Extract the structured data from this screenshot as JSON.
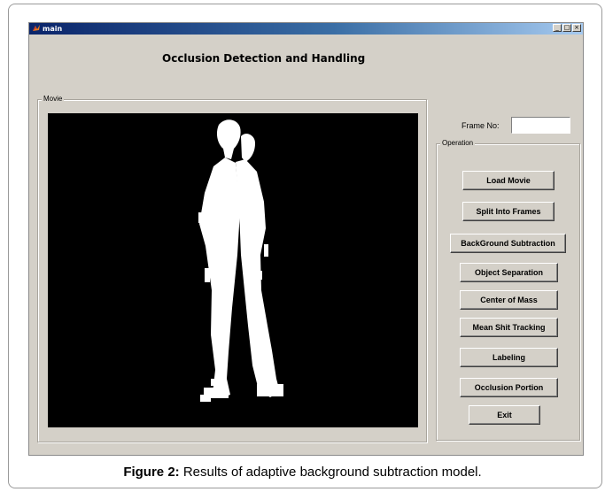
{
  "window": {
    "title": "main",
    "controls": {
      "minimize": "_",
      "maximize": "□",
      "close": "×"
    }
  },
  "heading": "Occlusion Detection and Handling",
  "movie_panel": {
    "label": "Movie"
  },
  "frame": {
    "label": "Frame No:",
    "value": ""
  },
  "operation_panel": {
    "label": "Operation",
    "buttons": [
      "Load Movie",
      "Split Into Frames",
      "BackGround Subtraction",
      "Object Separation",
      "Center of Mass",
      "Mean Shit Tracking",
      "Labeling",
      "Occlusion Portion",
      "Exit"
    ]
  },
  "caption": {
    "prefix": "Figure 2:",
    "text": " Results of adaptive background subtraction model."
  }
}
